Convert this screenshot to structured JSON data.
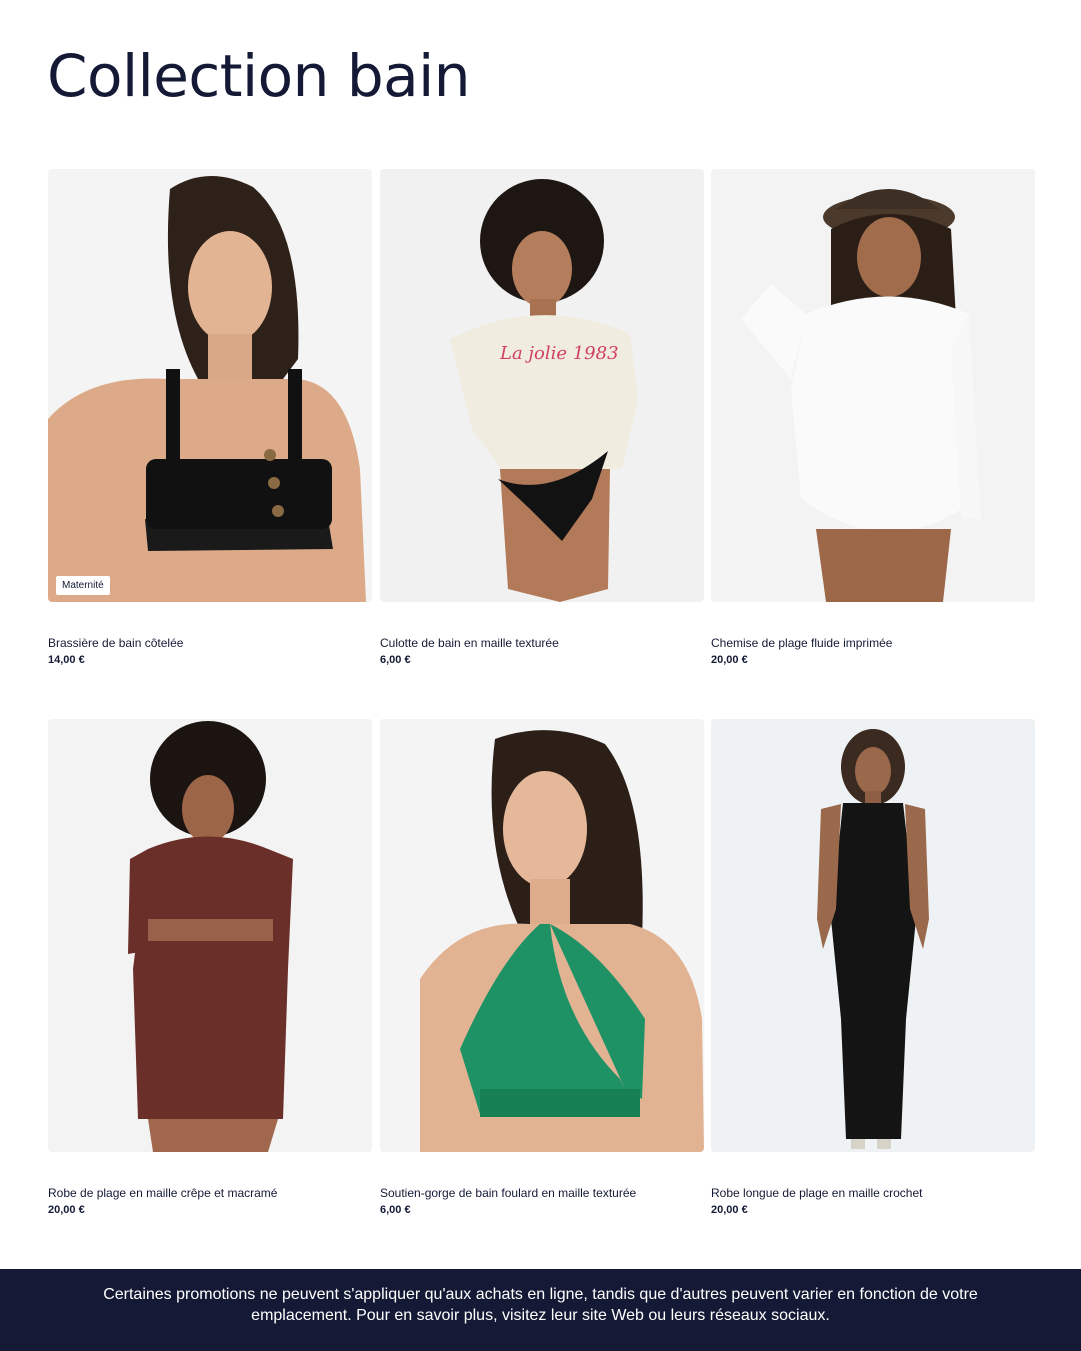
{
  "page": {
    "title": "Collection bain"
  },
  "products": [
    {
      "name": "Brassière de bain côtelée",
      "price": "14,00 €",
      "badge": "Maternité",
      "image_icon": "black-ribbed-bikini-top-photo"
    },
    {
      "name": "Culotte de bain en maille texturée",
      "price": "6,00 €",
      "badge": "",
      "image_icon": "black-textured-bikini-bottom-photo"
    },
    {
      "name": "Chemise de plage fluide imprimée",
      "price": "20,00 €",
      "badge": "",
      "image_icon": "white-beach-shirt-photo"
    },
    {
      "name": "Robe de plage en maille crêpe et macramé",
      "price": "20,00 €",
      "badge": "",
      "image_icon": "burgundy-beach-dress-photo"
    },
    {
      "name": "Soutien-gorge de bain foulard en maille texturée",
      "price": "6,00 €",
      "badge": "",
      "image_icon": "green-bikini-top-photo"
    },
    {
      "name": "Robe longue de plage en maille crochet",
      "price": "20,00 €",
      "badge": "",
      "image_icon": "black-crochet-maxi-dress-photo"
    }
  ],
  "footer": {
    "notice": "Certaines promotions ne peuvent s'appliquer qu'aux achats en ligne, tandis que d'autres peuvent varier en fonction de votre emplacement. Pour en savoir plus, visitez leur site Web ou leurs réseaux sociaux."
  },
  "colors": {
    "navy": "#141a35",
    "background": "#ffffff"
  }
}
